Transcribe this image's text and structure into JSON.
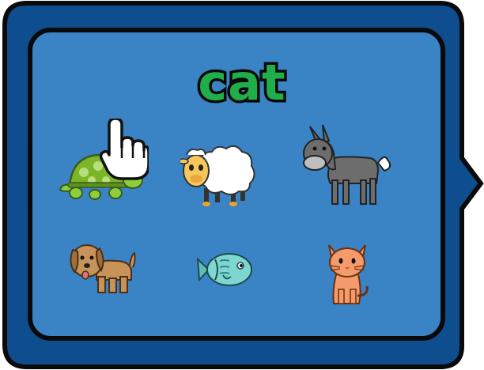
{
  "prompt": {
    "word": "cat"
  },
  "choices": [
    {
      "animal": "turtle",
      "icon": "turtle-icon"
    },
    {
      "animal": "sheep",
      "icon": "sheep-icon"
    },
    {
      "animal": "donkey",
      "icon": "donkey-icon"
    },
    {
      "animal": "dog",
      "icon": "dog-icon"
    },
    {
      "animal": "fish",
      "icon": "fish-icon"
    },
    {
      "animal": "cat",
      "icon": "cat-icon"
    }
  ],
  "colors": {
    "frame_outer": "#0e4e8e",
    "panel": "#3a84c6",
    "word_fill": "#1fae4a",
    "outline": "#0a0a0a"
  },
  "pointer": {
    "icon": "hand-pointer-icon"
  }
}
